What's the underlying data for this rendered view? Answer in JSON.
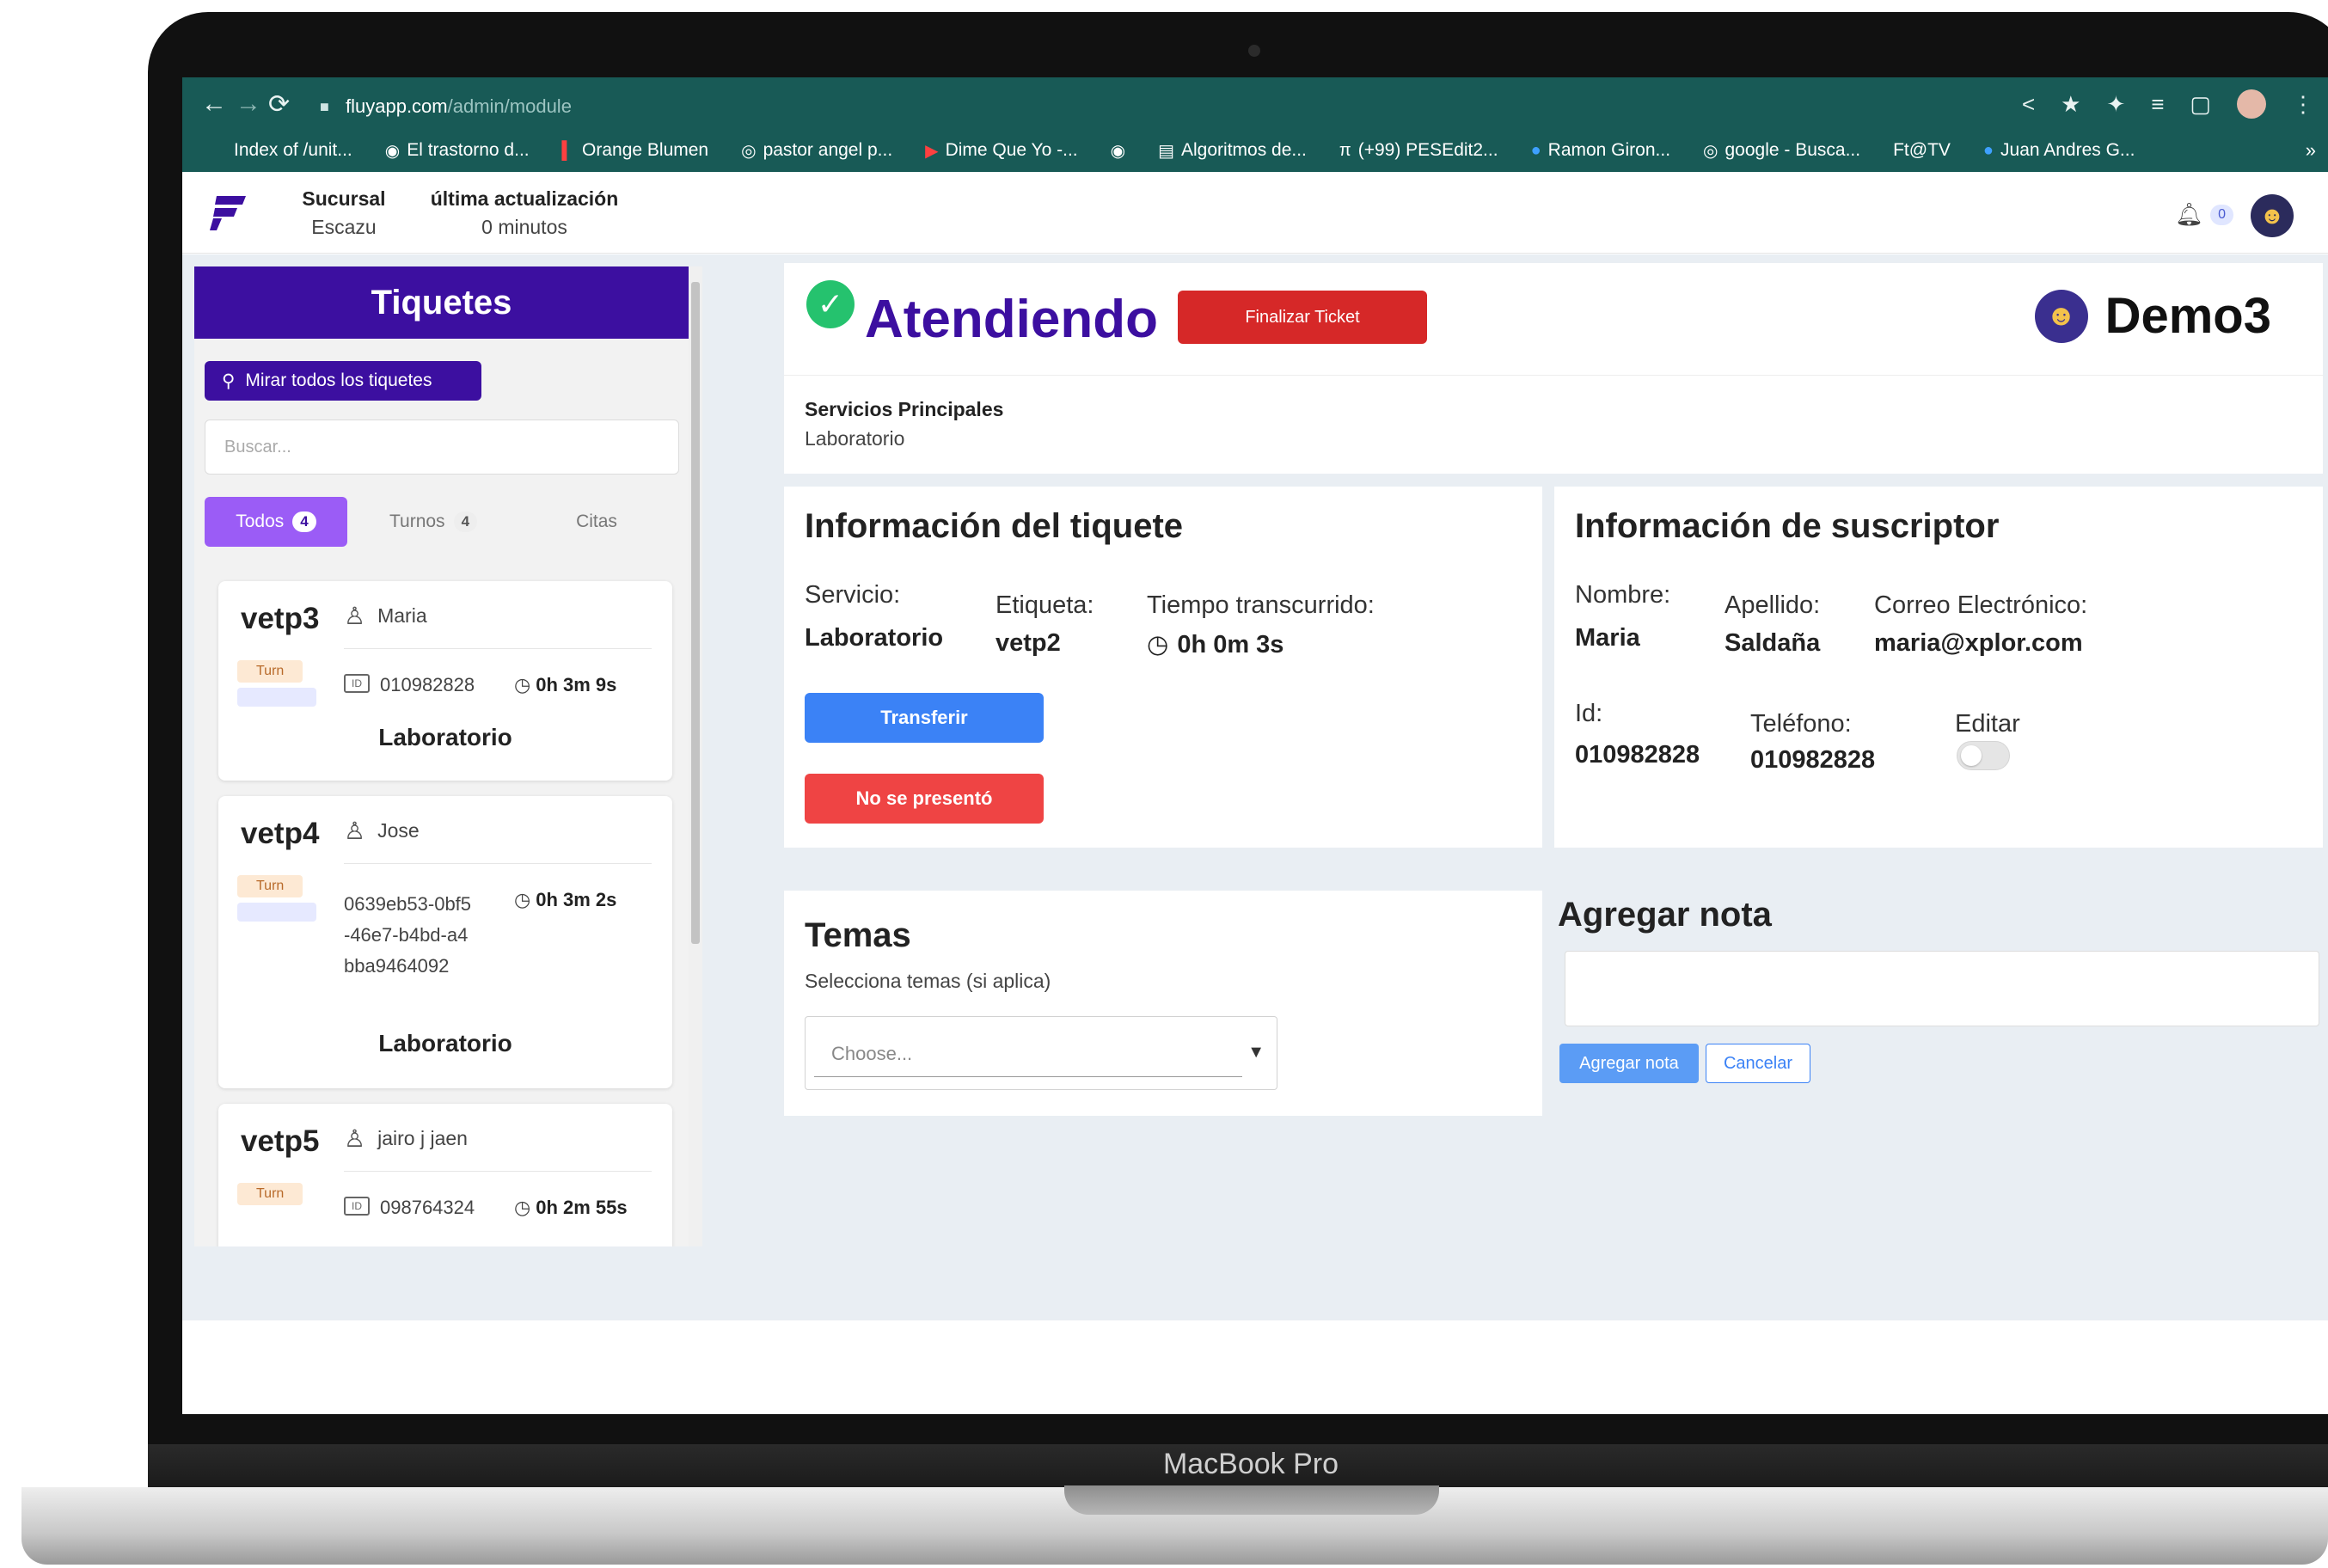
{
  "device": {
    "model_label": "MacBook Pro"
  },
  "browser": {
    "url_host": "fluyapp.com",
    "url_path": "/admin/module",
    "bookmarks": [
      {
        "label": "Index of /unit...",
        "icon": "folder-icon"
      },
      {
        "label": "El trastorno d...",
        "icon": "globe-icon"
      },
      {
        "label": "Orange Blumen",
        "icon": "bar-icon"
      },
      {
        "label": "pastor angel p...",
        "icon": "google-icon"
      },
      {
        "label": "Dime Que Yo -...",
        "icon": "youtube-icon"
      },
      {
        "label": "",
        "icon": "globe-icon"
      },
      {
        "label": "Algoritmos de...",
        "icon": "bookmark-icon"
      },
      {
        "label": "(+99) PESEdit2...",
        "icon": "forum-icon"
      },
      {
        "label": "Ramon Giron...",
        "icon": "facebook-icon"
      },
      {
        "label": "google - Busca...",
        "icon": "google-icon"
      },
      {
        "label": "Ft@TV",
        "icon": ""
      },
      {
        "label": "Juan Andres G...",
        "icon": "facebook-icon"
      }
    ]
  },
  "header": {
    "branch_title": "Sucursal",
    "branch_value": "Escazu",
    "updated_title": "última actualización",
    "updated_value": "0 minutos",
    "notification_count": "0"
  },
  "sidebar": {
    "title": "Tiquetes",
    "view_all_label": "Mirar todos los tiquetes",
    "search_placeholder": "Buscar...",
    "tabs": [
      {
        "label": "Todos",
        "count": "4"
      },
      {
        "label": "Turnos",
        "count": "4"
      },
      {
        "label": "Citas",
        "count": ""
      }
    ],
    "tickets": [
      {
        "code": "vetp3",
        "name": "Maria",
        "type": "Turn",
        "id": "010982828",
        "time": "0h 3m 9s",
        "service": "Laboratorio"
      },
      {
        "code": "vetp4",
        "name": "Jose",
        "type": "Turn",
        "id": "0639eb53-0bf5-46e7-b4bd-a4bba9464092",
        "time": "0h 3m 2s",
        "service": "Laboratorio"
      },
      {
        "code": "vetp5",
        "name": "jairo j jaen",
        "type": "Turn",
        "id": "098764324",
        "time": "0h 2m 55s",
        "service": ""
      }
    ]
  },
  "status": {
    "title": "Atendiendo",
    "finish_button": "Finalizar Ticket",
    "tenant": "Demo3"
  },
  "services": {
    "title": "Servicios Principales",
    "value": "Laboratorio"
  },
  "ticket_info": {
    "title": "Información del tiquete",
    "service_label": "Servicio:",
    "service_value": "Laboratorio",
    "tag_label": "Etiqueta:",
    "tag_value": "vetp2",
    "elapsed_label": "Tiempo transcurrido:",
    "elapsed_value": "0h 0m 3s",
    "transfer_button": "Transferir",
    "noshow_button": "No se presentó"
  },
  "subscriber": {
    "title": "Información de suscriptor",
    "name_label": "Nombre:",
    "name_value": "Maria",
    "lastname_label": "Apellido:",
    "lastname_value": "Saldaña",
    "email_label": "Correo Electrónico:",
    "email_value": "maria@xplor.com",
    "id_label": "Id:",
    "id_value": "010982828",
    "phone_label": "Teléfono:",
    "phone_value": "010982828",
    "edit_label": "Editar",
    "edit_enabled": false
  },
  "topics": {
    "title": "Temas",
    "help": "Selecciona temas (si aplica)",
    "placeholder": "Choose..."
  },
  "note": {
    "title": "Agregar nota",
    "add_button": "Agregar nota",
    "cancel_button": "Cancelar"
  },
  "colors": {
    "browser_bar": "#185a56",
    "brand_purple": "#3c0fa0",
    "active_tab": "#9b5cf6",
    "success_green": "#25c26e",
    "danger_red": "#d62828",
    "primary_blue": "#3b82f6"
  }
}
